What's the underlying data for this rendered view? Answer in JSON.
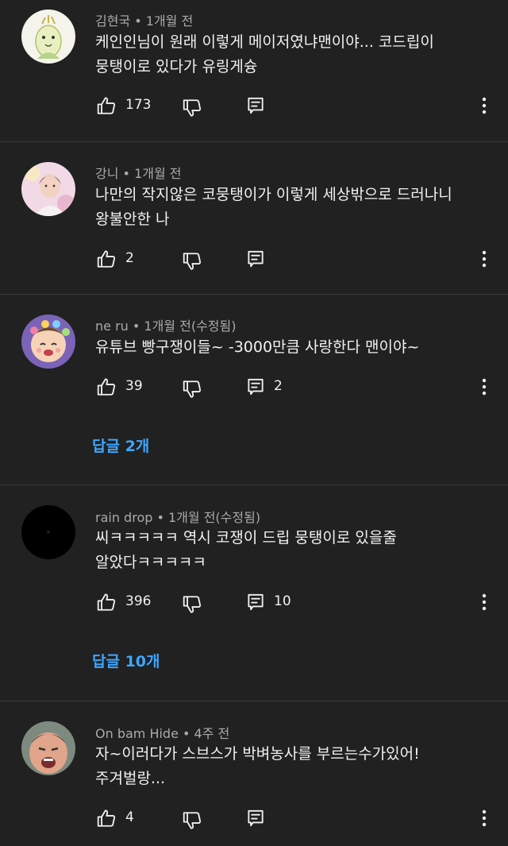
{
  "comments": [
    {
      "author": "김현국",
      "time": "1개월 전",
      "lines": [
        "케인인님이 원래 이렇게 메이저였냐맨이야... 코드립이",
        "뭉탱이로 있다가 유링게슝"
      ],
      "likes": "173",
      "reply_count": "",
      "replies_label": ""
    },
    {
      "author": "강니",
      "time": "1개월 전",
      "lines": [
        "나만의 작지않은 코뭉탱이가 이렇게 세상밖으로 드러나니",
        "왕불안한 나"
      ],
      "likes": "2",
      "reply_count": "",
      "replies_label": ""
    },
    {
      "author": "ne ru",
      "time": "1개월 전(수정됨)",
      "lines": [
        "유튜브 빵구쟁이들~ -3000만큼 사랑한다 맨이야~"
      ],
      "likes": "39",
      "reply_count": "2",
      "replies_label": "답글 2개"
    },
    {
      "author": "rain drop",
      "time": "1개월 전(수정됨)",
      "lines": [
        "씨ㅋㅋㅋㅋㅋ 역시 코쟁이 드립 뭉탱이로 있을줄",
        "알았다ㅋㅋㅋㅋㅋ"
      ],
      "likes": "396",
      "reply_count": "10",
      "replies_label": "답글 10개"
    },
    {
      "author": "On bam Hide",
      "time": "4주 전",
      "lines": [
        "자~이러다가 스브스가 박벼농사를 부르는수가있어!",
        "주겨벌랑..."
      ],
      "likes": "4",
      "reply_count": "",
      "replies_label": ""
    }
  ],
  "separator": " • ",
  "icons": {
    "like": "thumbs-up-icon",
    "dislike": "thumbs-down-icon",
    "reply": "reply-icon",
    "more": "more-vertical-icon"
  },
  "colors": {
    "background": "#212121",
    "text": "#f1f1f1",
    "meta": "#aaaaaa",
    "link": "#3ea6ff"
  }
}
